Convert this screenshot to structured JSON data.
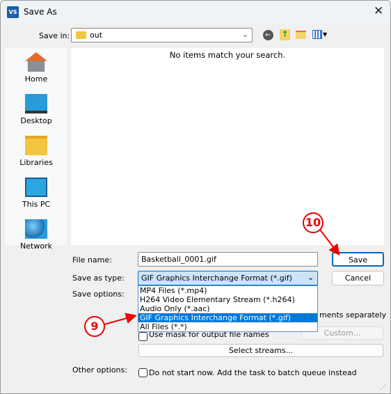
{
  "window": {
    "title": "Save As",
    "app_icon": "VS"
  },
  "toolbar": {
    "save_in_label": "Save in:",
    "folder": "out",
    "icons": [
      "back-icon",
      "up-folder-icon",
      "new-folder-icon",
      "view-menu-icon"
    ]
  },
  "sidebar": {
    "items": [
      {
        "label": "Home",
        "icon": "home-icon"
      },
      {
        "label": "Desktop",
        "icon": "desktop-icon"
      },
      {
        "label": "Libraries",
        "icon": "libraries-icon"
      },
      {
        "label": "This PC",
        "icon": "this-pc-icon"
      },
      {
        "label": "Network",
        "icon": "network-icon"
      }
    ]
  },
  "file_list": {
    "empty_message": "No items match your search."
  },
  "form": {
    "file_name_label": "File name:",
    "file_name": "Basketball_0001.gif",
    "save_type_label": "Save as type:",
    "save_type": "GIF Graphics Interchange Format (*.gif)",
    "save_label": "Save",
    "cancel_label": "Cancel",
    "save_options_label": "Save options:",
    "separately_text": "ments separately",
    "mask_text": "Use mask for output file names",
    "custom_label": "Custom...",
    "select_streams_label": "Select streams...",
    "other_options_label": "Other options:",
    "batch_text": "Do not start now. Add the task to batch queue instead"
  },
  "dropdown": {
    "options": [
      "MP4 Files (*.mp4)",
      "H264 Video Elementary Stream (*.h264)",
      "Audio Only (*.aac)",
      "GIF Graphics Interchange Format (*.gif)",
      "All Files (*.*)"
    ],
    "selected_index": 3
  },
  "annotations": {
    "step9": "9",
    "step10": "10",
    "color": "#e00000"
  }
}
